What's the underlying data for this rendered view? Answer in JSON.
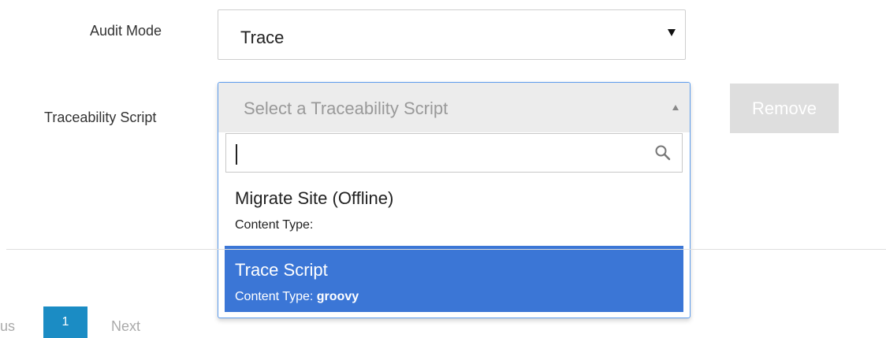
{
  "form": {
    "audit_mode_label": "Audit Mode",
    "audit_mode_value": "Trace",
    "traceability_label": "Traceability Script",
    "traceability_placeholder": "Select a Traceability Script",
    "search_value": "",
    "remove_label": "Remove"
  },
  "dropdown_options": [
    {
      "title": "Migrate Site (Offline)",
      "content_type_label": "Content Type:",
      "content_type_value": ""
    },
    {
      "title": "Trace Script",
      "content_type_label": "Content Type:",
      "content_type_value": "groovy"
    }
  ],
  "pagination": {
    "prev_label": "us",
    "current_page": "1",
    "next_label": "Next"
  },
  "colors": {
    "highlight": "#3b76d6",
    "focus_border": "#5d9cec",
    "page_active": "#1b8cc4",
    "button_disabled": "#dedede"
  },
  "icons": {
    "search": "search-icon",
    "caret_down": "chevron-down-icon",
    "caret_up": "chevron-up-icon"
  }
}
